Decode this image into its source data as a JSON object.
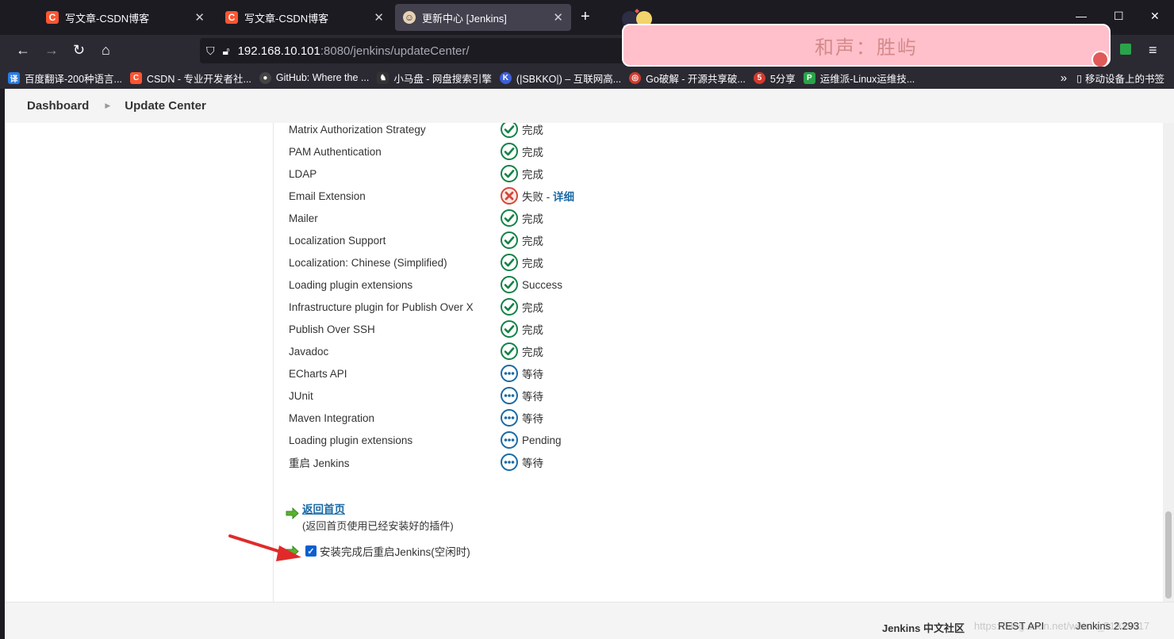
{
  "browser": {
    "tabs": [
      {
        "title": "写文章-CSDN博客",
        "icon": "csdn-icon",
        "active": false
      },
      {
        "title": "写文章-CSDN博客",
        "icon": "csdn-icon",
        "active": false
      },
      {
        "title": "更新中心 [Jenkins]",
        "icon": "jenkins-icon",
        "active": true
      }
    ],
    "url_host": "192.168.10.101",
    "url_rest": ":8080/jenkins/updateCenter/",
    "banner_text": "和声：胜屿",
    "bookmarks": [
      {
        "label": "百度翻译-200种语言...",
        "icon": "translate-icon",
        "color": "#2a7ae2"
      },
      {
        "label": "CSDN - 专业开发者社...",
        "icon": "csdn-icon",
        "color": "#fc5531"
      },
      {
        "label": "GitHub: Where the ...",
        "icon": "github-icon",
        "color": "#444444"
      },
      {
        "label": "小马盘 - 网盘搜索引擎",
        "icon": "horse-icon",
        "color": "#333333"
      },
      {
        "label": "(|SBKKO|) – 互联网高...",
        "icon": "k-icon",
        "color": "#3d5fd9"
      },
      {
        "label": "Go破解 - 开源共享破...",
        "icon": "target-icon",
        "color": "#d33a2c"
      },
      {
        "label": "5分享",
        "icon": "five-icon",
        "color": "#d33a2c"
      },
      {
        "label": "运维派-Linux运维技...",
        "icon": "p-icon",
        "color": "#2aa34a"
      }
    ],
    "bookmarks_mobile": "移动设备上的书签"
  },
  "breadcrumbs": {
    "dashboard": "Dashboard",
    "current": "Update Center"
  },
  "plugins": [
    {
      "name": "Matrix Authorization Strategy",
      "status": "完成",
      "state": "success"
    },
    {
      "name": "PAM Authentication",
      "status": "完成",
      "state": "success"
    },
    {
      "name": "LDAP",
      "status": "完成",
      "state": "success"
    },
    {
      "name": "Email Extension",
      "status": "失败 - ",
      "state": "failure",
      "detail": "详细"
    },
    {
      "name": "Mailer",
      "status": "完成",
      "state": "success"
    },
    {
      "name": "Localization Support",
      "status": "完成",
      "state": "success"
    },
    {
      "name": "Localization: Chinese (Simplified)",
      "status": "完成",
      "state": "success"
    },
    {
      "name": "Loading plugin extensions",
      "status": "Success",
      "state": "success"
    },
    {
      "name": "Infrastructure plugin for Publish Over X",
      "status": "完成",
      "state": "success"
    },
    {
      "name": "Publish Over SSH",
      "status": "完成",
      "state": "success"
    },
    {
      "name": "Javadoc",
      "status": "完成",
      "state": "success"
    },
    {
      "name": "ECharts API",
      "status": "等待",
      "state": "pending"
    },
    {
      "name": "JUnit",
      "status": "等待",
      "state": "pending"
    },
    {
      "name": "Maven Integration",
      "status": "等待",
      "state": "pending"
    },
    {
      "name": "Loading plugin extensions",
      "status": "Pending",
      "state": "pending"
    },
    {
      "name": "重启 Jenkins",
      "status": "等待",
      "state": "pending"
    }
  ],
  "back": {
    "link": "返回首页",
    "note": "(返回首页使用已经安装好的插件)"
  },
  "restart": {
    "label": "安装完成后重启Jenkins(空闲时)",
    "checked": true
  },
  "footer": {
    "community": "Jenkins 中文社区",
    "rest_api": "REST API",
    "version": "Jenkins 2.293",
    "watermark": "https://blog.csdn.net/weixin_51933617"
  },
  "colors": {
    "success": "#138347",
    "failure": "#d24939",
    "pending": "#1b6aa5"
  }
}
